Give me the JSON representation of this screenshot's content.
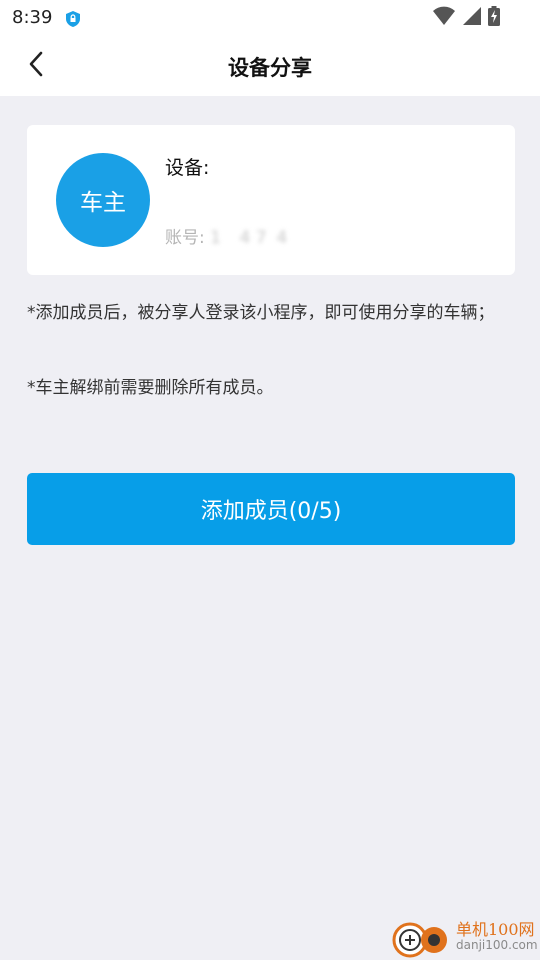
{
  "status_bar": {
    "time": "8:39",
    "icons": [
      "shield-icon",
      "wifi-icon",
      "signal-icon",
      "battery-charging-icon"
    ],
    "accent_color": "#1aa0e6"
  },
  "header": {
    "title": "设备分享",
    "back_icon": "chevron-left-icon"
  },
  "device_card": {
    "avatar_text": "车主",
    "device_label": "设备:",
    "account_label": "账号:",
    "account_value": "1    4 7  4"
  },
  "notes": [
    "*添加成员后，被分享人登录该小程序，即可使用分享的车辆；",
    "*车主解绑前需要删除所有成员。"
  ],
  "actions": {
    "add_member_label": "添加成员(0/5)",
    "button_color": "#079ee8"
  },
  "watermark": {
    "line1": "单机100网",
    "line2": "danji100.com"
  }
}
